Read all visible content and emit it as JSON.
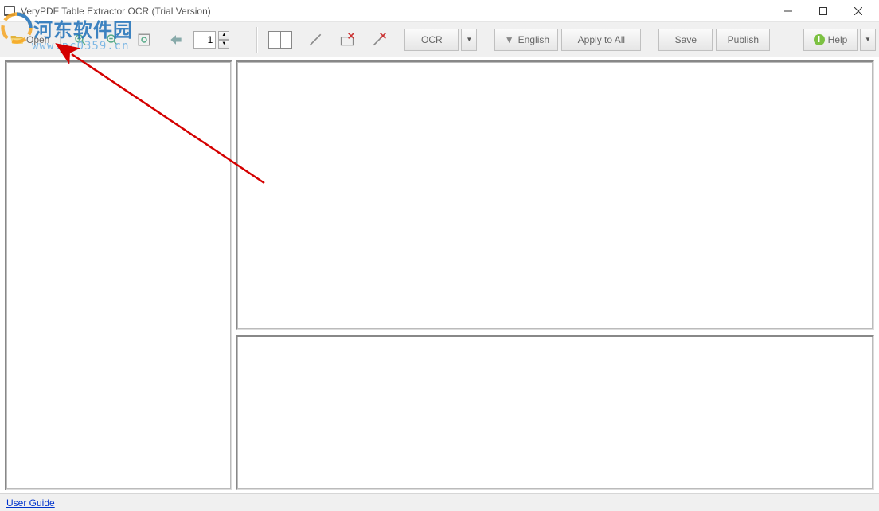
{
  "title": "VeryPDF Table Extractor OCR (Trial Version)",
  "watermark": {
    "text": "河东软件园",
    "url": "www.pc0359.cn"
  },
  "toolbar": {
    "open": "Open",
    "page": "1",
    "ocr": "OCR",
    "english": "English",
    "apply_all": "Apply to All",
    "save": "Save",
    "publish": "Publish",
    "help": "Help"
  },
  "statusbar": {
    "user_guide": "User Guide"
  }
}
